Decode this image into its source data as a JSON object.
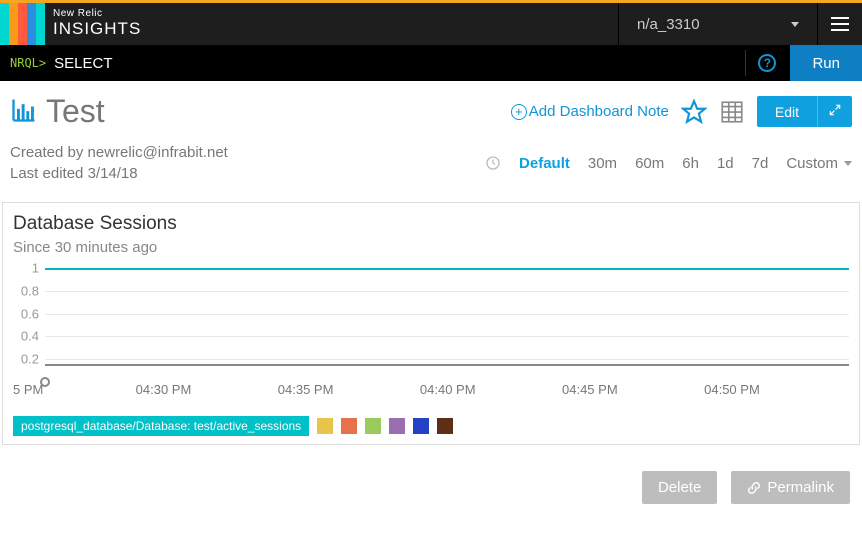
{
  "header": {
    "brand_small": "New Relic",
    "brand_main": "INSIGHTS",
    "account_name": "n/a_3310"
  },
  "nrql": {
    "label": "NRQL>",
    "value": "SELECT",
    "run_label": "Run"
  },
  "dashboard": {
    "title": "Test",
    "add_note_label": "Add Dashboard Note",
    "edit_label": "Edit",
    "created_by_label": "Created by",
    "created_by_value": "newrelic@infrabit.net",
    "last_edited_label": "Last edited",
    "last_edited_value": "3/14/18"
  },
  "time_picker": {
    "default_label": "Default",
    "options": [
      "30m",
      "60m",
      "6h",
      "1d",
      "7d"
    ],
    "custom_label": "Custom"
  },
  "widget": {
    "title": "Database Sessions",
    "subtitle": "Since 30 minutes ago",
    "legend_main": "postgresql_database/Database: test/active_sessions"
  },
  "legend_colors": [
    "#e9c44a",
    "#e8714d",
    "#9bcb5b",
    "#9a6fb0",
    "#2442c4",
    "#5c2f16"
  ],
  "footer": {
    "delete_label": "Delete",
    "permalink_label": "Permalink"
  },
  "chart_data": {
    "type": "line",
    "title": "Database Sessions",
    "subtitle": "Since 30 minutes ago",
    "xlabel": "",
    "ylabel": "",
    "ylim": [
      0,
      1
    ],
    "yticks": [
      1,
      0.8,
      0.6,
      0.4,
      0.2
    ],
    "categories": [
      "5 PM",
      "04:30 PM",
      "04:35 PM",
      "04:40 PM",
      "04:45 PM",
      "04:50 PM"
    ],
    "series": [
      {
        "name": "postgresql_database/Database: test/active_sessions",
        "color": "#00c0c8",
        "values": [
          1,
          1,
          1,
          1,
          1,
          1
        ]
      }
    ]
  }
}
